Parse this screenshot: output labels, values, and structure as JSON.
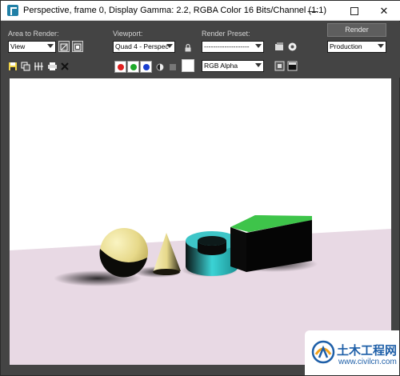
{
  "window": {
    "title": "Perspective, frame 0, Display Gamma: 2.2, RGBA Color 16 Bits/Channel (1:1)",
    "controls": {
      "minimize": "—",
      "close": "✕"
    }
  },
  "toolbar": {
    "area_to_render_label": "Area to Render:",
    "area_to_render_value": "View",
    "viewport_label": "Viewport:",
    "viewport_value": "Quad 4 - Perspec",
    "render_preset_label": "Render Preset:",
    "render_preset_value": "--------------------",
    "render_button": "Render",
    "production_value": "Production",
    "channel_value": "RGB Alpha",
    "channel_colors": {
      "red": "#e02020",
      "green": "#1faa2a",
      "blue": "#1a3fd0"
    }
  },
  "scene": {
    "floor_color": "#e8d9e4",
    "background_color": "#ffffff",
    "sphere_color": "#f1e79a",
    "cone_color": "#efe4a0",
    "torus_color": "#2ec1c4",
    "box_top_color": "#3ec44a",
    "box_side_color": "#0a0a0a"
  },
  "watermark": {
    "name": "土木工程网",
    "url": "www.civilcn.com"
  }
}
